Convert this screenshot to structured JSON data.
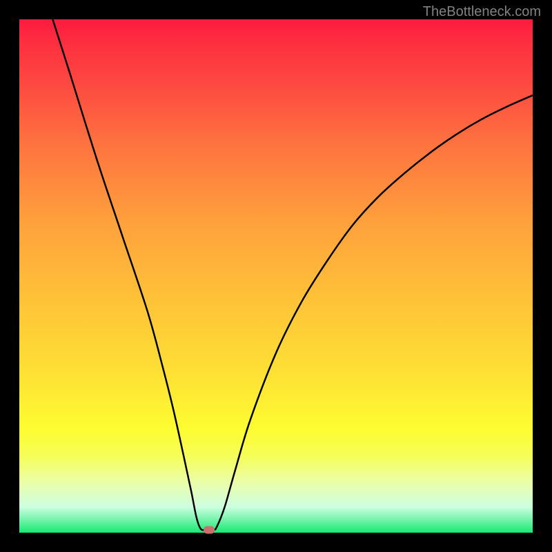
{
  "watermark": "TheBottleneck.com",
  "chart_data": {
    "type": "line",
    "title": "",
    "xlabel": "",
    "ylabel": "",
    "xlim": [
      0,
      100
    ],
    "ylim": [
      0,
      100
    ],
    "curve_points": [
      {
        "x": 6.5,
        "y": 100
      },
      {
        "x": 10,
        "y": 89
      },
      {
        "x": 15,
        "y": 73
      },
      {
        "x": 20,
        "y": 58
      },
      {
        "x": 25,
        "y": 43
      },
      {
        "x": 28,
        "y": 32
      },
      {
        "x": 30,
        "y": 24
      },
      {
        "x": 32,
        "y": 15
      },
      {
        "x": 33.5,
        "y": 8
      },
      {
        "x": 34.5,
        "y": 3
      },
      {
        "x": 35.3,
        "y": 0.8
      },
      {
        "x": 36.2,
        "y": 0.5
      },
      {
        "x": 37.8,
        "y": 0.5
      },
      {
        "x": 38.5,
        "y": 1.2
      },
      {
        "x": 40,
        "y": 5
      },
      {
        "x": 42,
        "y": 12
      },
      {
        "x": 45,
        "y": 22
      },
      {
        "x": 50,
        "y": 35
      },
      {
        "x": 55,
        "y": 45
      },
      {
        "x": 60,
        "y": 53
      },
      {
        "x": 65,
        "y": 60
      },
      {
        "x": 70,
        "y": 65.5
      },
      {
        "x": 75,
        "y": 70
      },
      {
        "x": 80,
        "y": 74
      },
      {
        "x": 85,
        "y": 77.5
      },
      {
        "x": 90,
        "y": 80.5
      },
      {
        "x": 95,
        "y": 83
      },
      {
        "x": 100,
        "y": 85.2
      }
    ],
    "marker": {
      "x": 37,
      "y": 0.5
    },
    "gradient_colors": {
      "top": "#fc1b3f",
      "middle": "#fee334",
      "bottom": "#17e971"
    }
  }
}
